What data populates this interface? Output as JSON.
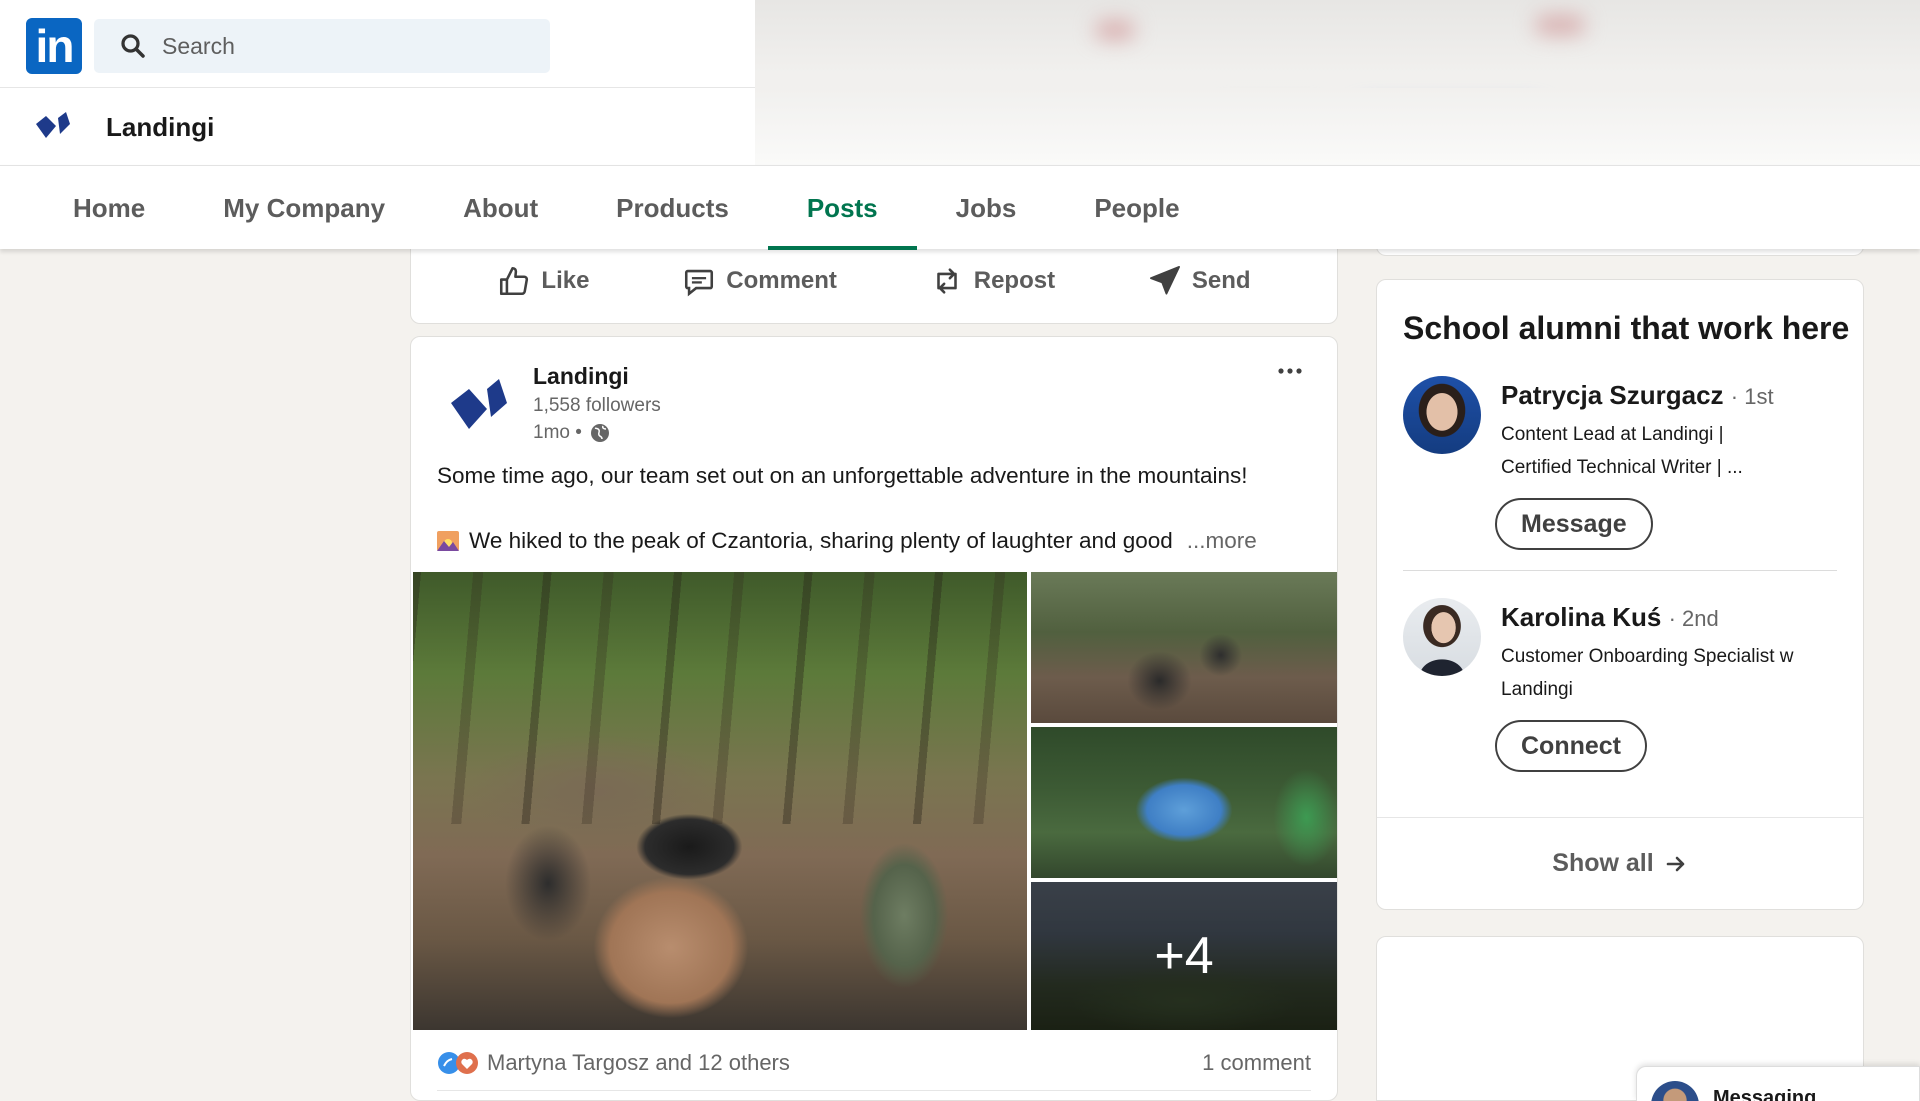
{
  "header": {
    "logo_text": "in",
    "search_placeholder": "Search"
  },
  "company": {
    "name": "Landingi"
  },
  "tabs": [
    {
      "label": "Home",
      "active": false
    },
    {
      "label": "My Company",
      "active": false
    },
    {
      "label": "About",
      "active": false
    },
    {
      "label": "Products",
      "active": false
    },
    {
      "label": "Posts",
      "active": true
    },
    {
      "label": "Jobs",
      "active": false
    },
    {
      "label": "People",
      "active": false
    }
  ],
  "post_actions": {
    "like": "Like",
    "comment": "Comment",
    "repost": "Repost",
    "send": "Send"
  },
  "post": {
    "author": "Landingi",
    "followers": "1,558 followers",
    "time": "1mo •",
    "text_line1": "Some time ago, our team set out on an unforgettable adventure in the mountains!",
    "text_line2": "We hiked to the peak of Czantoria, sharing plenty of laughter and good",
    "see_more": "...more",
    "more_photos": "+4",
    "reactions_text": "Martyna Targosz and 12 others",
    "comments": "1 comment"
  },
  "alumni": {
    "title": "School alumni that work here",
    "people": [
      {
        "name": "Patrycja Szurgacz",
        "degree": "· 1st",
        "headline_line1": "Content Lead at Landingi  |",
        "headline_line2": "Certified Technical Writer  | ...",
        "button": "Message"
      },
      {
        "name": "Karolina Kuś",
        "degree": "· 2nd",
        "headline_line1": "Customer Onboarding Specialist w",
        "headline_line2": "Landingi",
        "button": "Connect"
      }
    ],
    "show_all": "Show all"
  },
  "messaging": {
    "label": "Messaging"
  },
  "colors": {
    "linkedin_blue": "#0a66c2",
    "active_tab_green": "#01754f",
    "landingi_blue": "#1e3a8a"
  }
}
